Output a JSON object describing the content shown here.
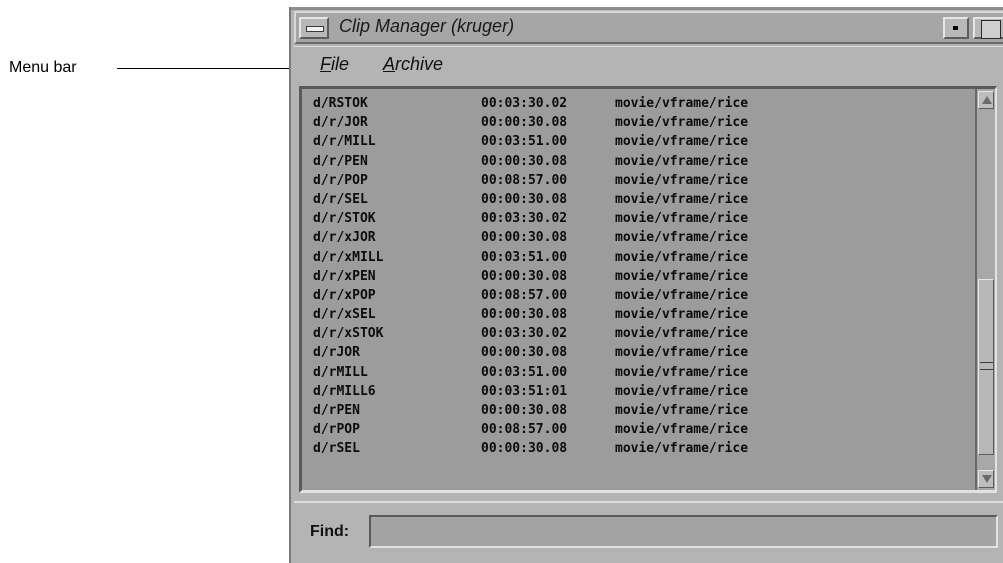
{
  "callout": {
    "label": "Menu bar"
  },
  "window": {
    "title": "Clip Manager (kruger)"
  },
  "menu": {
    "file": {
      "mnemonic": "F",
      "rest": "ile"
    },
    "archive": {
      "mnemonic": "A",
      "rest": "rchive"
    }
  },
  "clips": [
    {
      "name": "d/RSTOK",
      "duration": "00:03:30.02",
      "path": "movie/vframe/rice"
    },
    {
      "name": "d/r/JOR",
      "duration": "00:00:30.08",
      "path": "movie/vframe/rice"
    },
    {
      "name": "d/r/MILL",
      "duration": "00:03:51.00",
      "path": "movie/vframe/rice"
    },
    {
      "name": "d/r/PEN",
      "duration": "00:00:30.08",
      "path": "movie/vframe/rice"
    },
    {
      "name": "d/r/POP",
      "duration": "00:08:57.00",
      "path": "movie/vframe/rice"
    },
    {
      "name": "d/r/SEL",
      "duration": "00:00:30.08",
      "path": "movie/vframe/rice"
    },
    {
      "name": "d/r/STOK",
      "duration": "00:03:30.02",
      "path": "movie/vframe/rice"
    },
    {
      "name": "d/r/xJOR",
      "duration": "00:00:30.08",
      "path": "movie/vframe/rice"
    },
    {
      "name": "d/r/xMILL",
      "duration": "00:03:51.00",
      "path": "movie/vframe/rice"
    },
    {
      "name": "d/r/xPEN",
      "duration": "00:00:30.08",
      "path": "movie/vframe/rice"
    },
    {
      "name": "d/r/xPOP",
      "duration": "00:08:57.00",
      "path": "movie/vframe/rice"
    },
    {
      "name": "d/r/xSEL",
      "duration": "00:00:30.08",
      "path": "movie/vframe/rice"
    },
    {
      "name": "d/r/xSTOK",
      "duration": "00:03:30.02",
      "path": "movie/vframe/rice"
    },
    {
      "name": "d/rJOR",
      "duration": "00:00:30.08",
      "path": "movie/vframe/rice"
    },
    {
      "name": "d/rMILL",
      "duration": "00:03:51.00",
      "path": "movie/vframe/rice"
    },
    {
      "name": "d/rMILL6",
      "duration": "00:03:51:01",
      "path": "movie/vframe/rice"
    },
    {
      "name": "d/rPEN",
      "duration": "00:00:30.08",
      "path": "movie/vframe/rice"
    },
    {
      "name": "d/rPOP",
      "duration": "00:08:57.00",
      "path": "movie/vframe/rice"
    },
    {
      "name": "d/rSEL",
      "duration": "00:00:30.08",
      "path": "movie/vframe/rice"
    }
  ],
  "find": {
    "label": "Find:",
    "value": ""
  }
}
